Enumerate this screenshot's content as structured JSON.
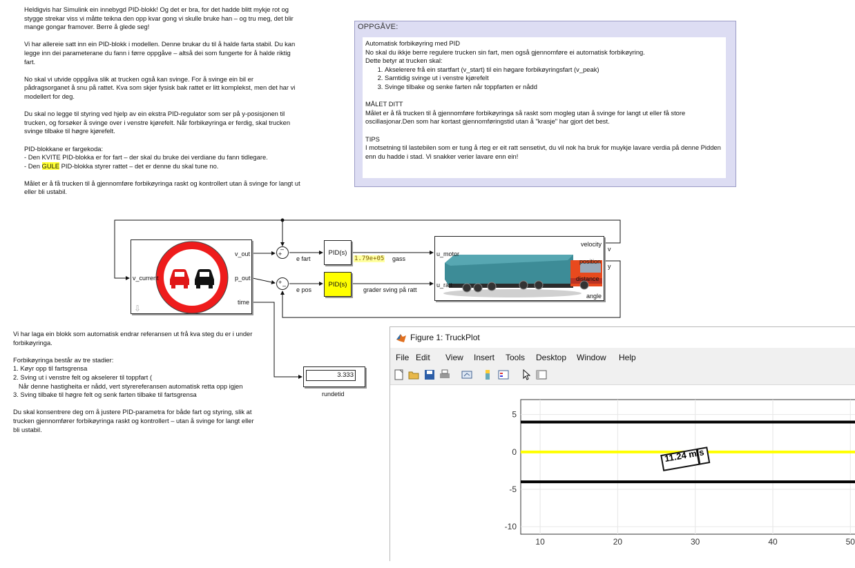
{
  "left_notes": {
    "p1": "Heldigvis har Simulink ein innebygd PID-blokk! Og det er bra, for det hadde blitt mykje rot og stygge strekar viss vi måtte teikna den opp kvar gong vi skulle bruke han – og tru meg, det blir mange gongar framover. Berre å glede seg!",
    "p2": "Vi har allereie satt inn ein PID-blokk i modellen. Denne brukar du til å halde farta stabil. Du kan legge inn dei parameterane du fann i førre oppgåve – altså dei som fungerte for å halde riktig fart.",
    "p3": "No skal vi utvide oppgåva slik at trucken også kan svinge. For å svinge ein bil er pådragsorganet å snu på rattet. Kva som skjer fysisk bak rattet er litt komplekst, men det har vi modellert for deg.",
    "p4": "Du skal no legge til styring ved hjelp av ein ekstra PID-regulator som ser på y-posisjonen til trucken, og forsøker å svinge over i venstre kjørefelt. Når forbikøyringa er ferdig, skal trucken svinge tilbake til høgre kjørefelt.",
    "p5_l1": "PID-blokkane er fargekoda:",
    "p5_l2": "- Den KVITE PID-blokka er for fart – der skal du bruke dei verdiane du fann tidlegare.",
    "p5_l3_a": "- Den ",
    "p5_l3_hl": "GULE",
    "p5_l3_b": " PID-blokka styrer rattet – det er denne du skal tune no.",
    "p6": "Målet er å få trucken til å gjennomføre forbikøyringa raskt og kontrollert utan å svinge for langt ut eller bli ustabil."
  },
  "task": {
    "title": "OPPGÅVE:",
    "heading": "Automatisk forbikøyring med PID",
    "intro": "No skal du ikkje berre regulere trucken sin fart, men også gjennomføre ei automatisk forbikøyring.",
    "means": "Dette betyr at trucken skal:",
    "steps": [
      "Akselerere frå ein startfart (v_start) til ein høgare forbikøyringsfart (v_peak)",
      "Samtidig svinge ut i venstre kjørefelt",
      "Svinge tilbake og senke farten når toppfarten er nådd"
    ],
    "goal_heading": "MÅLET DITT",
    "goal": "Målet er å få trucken til å gjennomføre forbikøyringa så raskt som mogleg utan å svinge for langt ut eller få store oscillasjonar.Den som har kortast gjennomføringstid utan å \"krasje\" har gjort det best.",
    "tips_heading": "TIPS",
    "tips": "I motsetning til lastebilen som er tung å rteg er eit ratt sensetivt, du vil nok ha bruk for muykje lavare verdia på denne Pidden enn du hadde i stad. Vi snakker verier lavare enn ein!"
  },
  "diagram": {
    "ref_block": {
      "in_port": "v_current",
      "out1": "v_out",
      "out2": "p_out",
      "out3": "time"
    },
    "sum1_label": "e fart",
    "sum2_label": "e pos",
    "pid1": "PID(s)",
    "pid2": "PID(s)",
    "gass_value": "1.79e+05",
    "gass_label": "gass",
    "sving_label": "grader sving på ratt",
    "truck_block": {
      "in1": "u_motor",
      "in2": "u_ratt",
      "out1": "velocity",
      "out2": "position",
      "out3": "distance",
      "out4": "angle"
    },
    "v_label": "v",
    "y_label": "y",
    "display_value": "3.333",
    "display_label": "rundetid"
  },
  "bottom_notes": {
    "p1": "Vi har laga ein blokk som automatisk endrar referansen ut frå kva steg du er i under forbikøyringa.",
    "p2_l1": "Forbikøyringa består av tre stadier:",
    "p2_l2": "1. Køyr opp til fartsgrensa",
    "p2_l3": "2. Sving ut i venstre felt og akselerer til toppfart (",
    "p2_l4": "   Når denne hastigheita er nådd, vert styrereferansen automatisk retta opp igjen",
    "p2_l5": "3. Sving tilbake til høgre felt og senk farten tilbake til fartsgrensa",
    "p3": "Du skal konsentrere deg om å justere PID-parametra for både fart og styring, slik at trucken gjennomfører forbikøyringa raskt og kontrollert – utan å svinge for langt eller bli ustabil."
  },
  "figure": {
    "title": "Figure 1: TruckPlot",
    "menu": [
      "File",
      "Edit",
      "View",
      "Insert",
      "Tools",
      "Desktop",
      "Window",
      "Help"
    ],
    "toolbar_icons": [
      "new-figure-icon",
      "open-file-icon",
      "save-icon",
      "print-icon",
      "link-plot-icon",
      "colorbar-icon",
      "legend-icon",
      "pointer-icon",
      "property-inspector-icon"
    ],
    "truck_label": "11.24 m/s"
  },
  "chart_data": {
    "type": "line",
    "title": "",
    "xlabel": "",
    "ylabel": "",
    "x_ticks": [
      10,
      20,
      30,
      40,
      50
    ],
    "y_ticks": [
      5,
      0,
      -5,
      -10
    ],
    "xlim": [
      7.5,
      53
    ],
    "ylim": [
      -11,
      7
    ],
    "grid": true,
    "series": [
      {
        "x": [
          7.5,
          53
        ],
        "y": [
          4,
          4
        ],
        "color": "#000000"
      },
      {
        "x": [
          7.5,
          53
        ],
        "y": [
          0,
          0
        ],
        "color": "#ffff00"
      },
      {
        "x": [
          7.5,
          53
        ],
        "y": [
          -4,
          -4
        ],
        "color": "#000000"
      }
    ]
  },
  "colors": {
    "pid_yellow": "#ffff00",
    "highlight": "#ffff33",
    "task_bg": "#ddddf3"
  }
}
